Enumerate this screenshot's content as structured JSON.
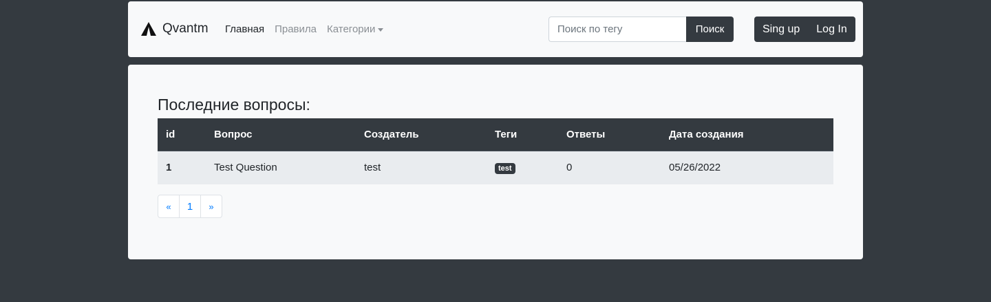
{
  "navbar": {
    "brand": "Qvantm",
    "links": [
      {
        "label": "Главная"
      },
      {
        "label": "Правила"
      },
      {
        "label": "Категории"
      }
    ],
    "search": {
      "placeholder": "Поиск по тегу",
      "value": "",
      "button": "Поиск"
    },
    "auth": {
      "signup": "Sing up",
      "login": "Log In"
    }
  },
  "main": {
    "heading": "Последние вопросы:",
    "table": {
      "headers": [
        "id",
        "Вопрос",
        "Создатель",
        "Теги",
        "Ответы",
        "Дата создания"
      ],
      "rows": [
        {
          "id": "1",
          "question": "Test Question",
          "creator": "test",
          "tag": "test",
          "answers": "0",
          "date": "05/26/2022"
        }
      ]
    },
    "pagination": {
      "prev": "«",
      "pages": [
        "1"
      ],
      "next": "»"
    }
  },
  "colors": {
    "background": "#343a40",
    "card": "#f8f9fa",
    "dark": "#343a40",
    "link": "#007bff"
  }
}
